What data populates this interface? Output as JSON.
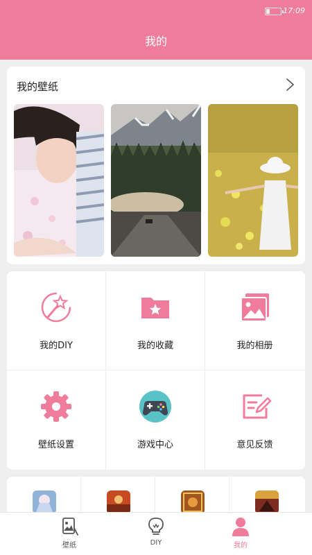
{
  "status_bar": {
    "time": "17:09"
  },
  "header": {
    "title": "我的"
  },
  "wallpapers": {
    "title": "我的壁纸"
  },
  "menu": {
    "items": [
      {
        "label": "我的DIY",
        "icon": "magic-wand-icon"
      },
      {
        "label": "我的收藏",
        "icon": "folder-star-icon"
      },
      {
        "label": "我的相册",
        "icon": "album-icon"
      },
      {
        "label": "壁纸设置",
        "icon": "gear-icon"
      },
      {
        "label": "游戏中心",
        "icon": "gamepad-icon"
      },
      {
        "label": "意见反馈",
        "icon": "feedback-edit-icon"
      }
    ]
  },
  "colors": {
    "accent": "#f07c9c",
    "background": "#efefef"
  },
  "tabbar": {
    "tabs": [
      {
        "label": "壁纸",
        "icon": "wallpaper-icon",
        "active": false
      },
      {
        "label": "DIY",
        "icon": "bulb-icon",
        "active": false
      },
      {
        "label": "我的",
        "icon": "person-icon",
        "active": true
      }
    ]
  }
}
